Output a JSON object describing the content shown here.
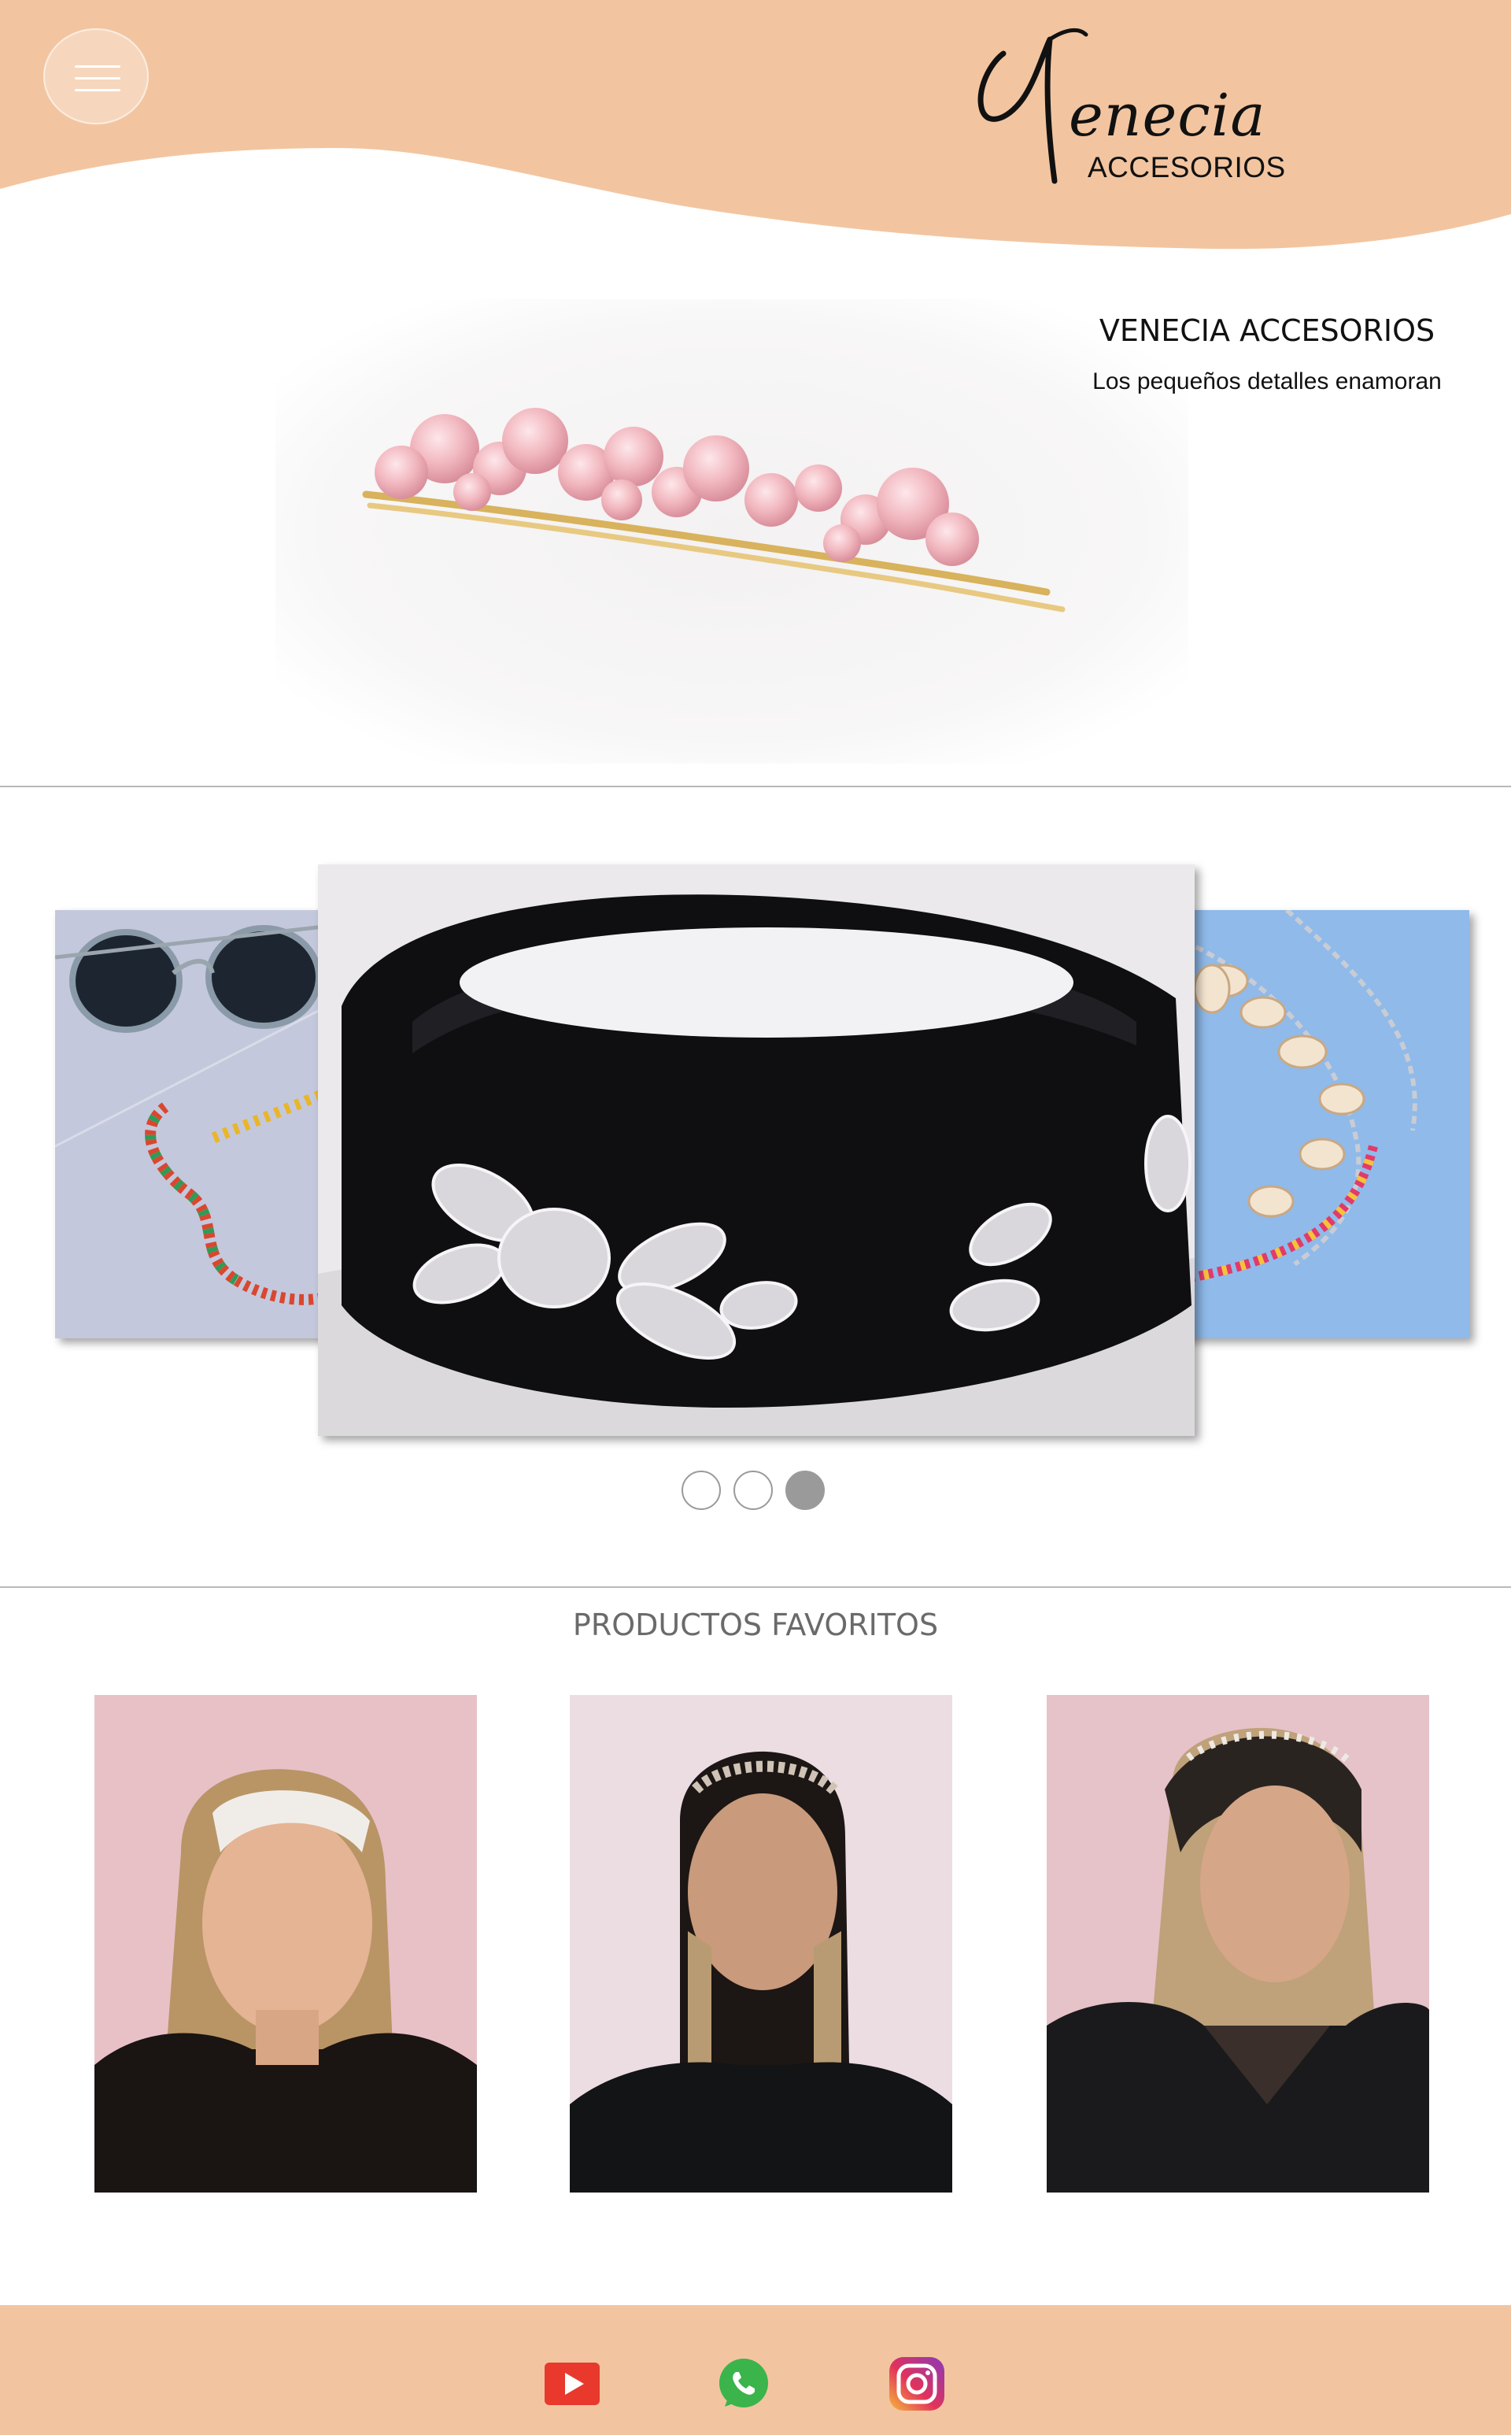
{
  "header": {
    "logo_script": "Venecia",
    "logo_sub": "ACCESORIOS",
    "menu_label": "menu",
    "brand_color": "#f2c5a0"
  },
  "hero": {
    "title": "VENECIA ACCESORIOS",
    "subtitle": "Los pequeños detalles enamoran",
    "image": "pink-crystal-hair-clip"
  },
  "carousel": {
    "slides": [
      {
        "image": "beaded-glasses-chain-with-sunglasses"
      },
      {
        "image": "black-velvet-headband-with-crystals"
      },
      {
        "image": "shell-and-bead-chain-necklace"
      }
    ],
    "dots": [
      false,
      false,
      true
    ]
  },
  "favorites": {
    "title": "PRODUCTOS FAVORITOS",
    "items": [
      {
        "image": "model-white-headband"
      },
      {
        "image": "model-beaded-headband"
      },
      {
        "image": "model-pearl-headband"
      }
    ]
  },
  "footer": {
    "social": [
      "youtube-icon",
      "whatsapp-icon",
      "instagram-icon"
    ],
    "colors": {
      "youtube": "#e8392c",
      "whatsapp": "#3bb44b",
      "instagram": "#d6287a"
    }
  }
}
